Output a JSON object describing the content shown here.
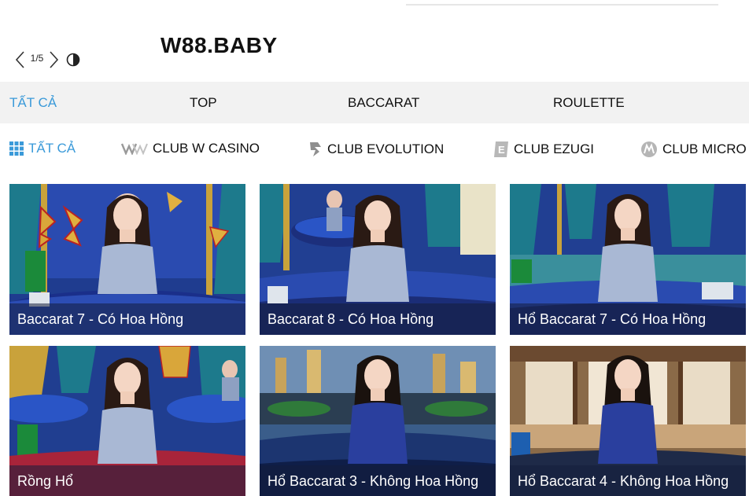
{
  "header": {
    "brand": "W88.BABY",
    "pager": {
      "current": "1",
      "separator": "/",
      "total": "5"
    },
    "icons": [
      "chevron-left-icon",
      "chevron-right-icon",
      "contrast-icon"
    ]
  },
  "categories": [
    {
      "label": "TẤT CẢ",
      "active": true
    },
    {
      "label": "TOP",
      "active": false
    },
    {
      "label": "BACCARAT",
      "active": false
    },
    {
      "label": "ROULETTE",
      "active": false
    }
  ],
  "providers": [
    {
      "label": "TẤT CẢ",
      "icon": "grid-icon",
      "active": true
    },
    {
      "label": "CLUB W CASINO",
      "icon": "w-casino-icon",
      "active": false
    },
    {
      "label": "CLUB EVOLUTION",
      "icon": "evolution-icon",
      "active": false
    },
    {
      "label": "CLUB EZUGI",
      "icon": "ezugi-icon",
      "active": false
    },
    {
      "label": "CLUB MICRO",
      "icon": "microgaming-icon",
      "active": false
    }
  ],
  "games": [
    {
      "title": "Baccarat 7 - Có Hoa Hồng",
      "theme": "blue-butterfly"
    },
    {
      "title": "Baccarat 8 - Có Hoa Hồng",
      "theme": "blue-butterfly"
    },
    {
      "title": "Hổ Baccarat 7 - Có Hoa Hồng",
      "theme": "blue-butterfly"
    },
    {
      "title": "Rồng Hổ",
      "theme": "blue-butterfly"
    },
    {
      "title": "Hổ Baccarat 3 - Không Hoa Hồng",
      "theme": "city-night"
    },
    {
      "title": "Hổ Baccarat 4 - Không Hoa Hồng",
      "theme": "wood-hall"
    }
  ],
  "colors": {
    "accent": "#3a9ad9",
    "cat_bar": "#f2f2f2"
  }
}
